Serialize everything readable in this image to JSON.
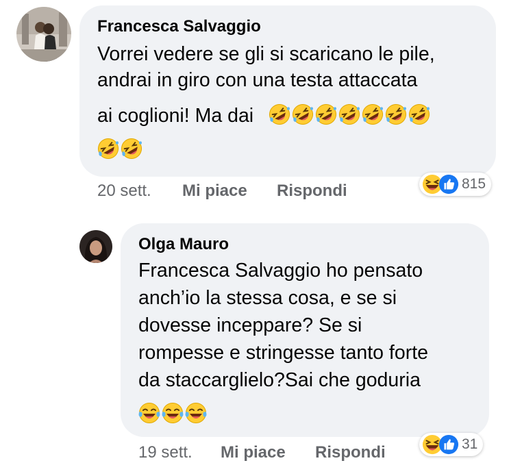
{
  "comment1": {
    "author": "Francesca Salvaggio",
    "lines": [
      "Vorrei vedere se gli si scaricano le pile,",
      "andrai in giro con una testa attaccata",
      "ai coglioni! Ma dai"
    ],
    "emoji_name": "rolling-on-floor-laughing",
    "time": "20 sett.",
    "like_label": "Mi piace",
    "reply_label": "Rispondi",
    "reaction_count": "815"
  },
  "comment2": {
    "author": "Olga Mauro",
    "lines": [
      "Francesca Salvaggio ho pensato",
      "anch’io la stessa cosa, e se si",
      "dovesse inceppare? Se si",
      "rompesse e stringesse tanto forte",
      "da staccarglielo?Sai che goduria"
    ],
    "emoji_name": "face-with-tears-of-joy",
    "time": "19 sett.",
    "like_label": "Mi piace",
    "reply_label": "Rispondi",
    "reaction_count": "31"
  },
  "colors": {
    "bubble": "#f0f2f5",
    "secondary_text": "#65676b",
    "like_blue": "#1877f2",
    "emoji_yellow": "#ffcc33"
  }
}
